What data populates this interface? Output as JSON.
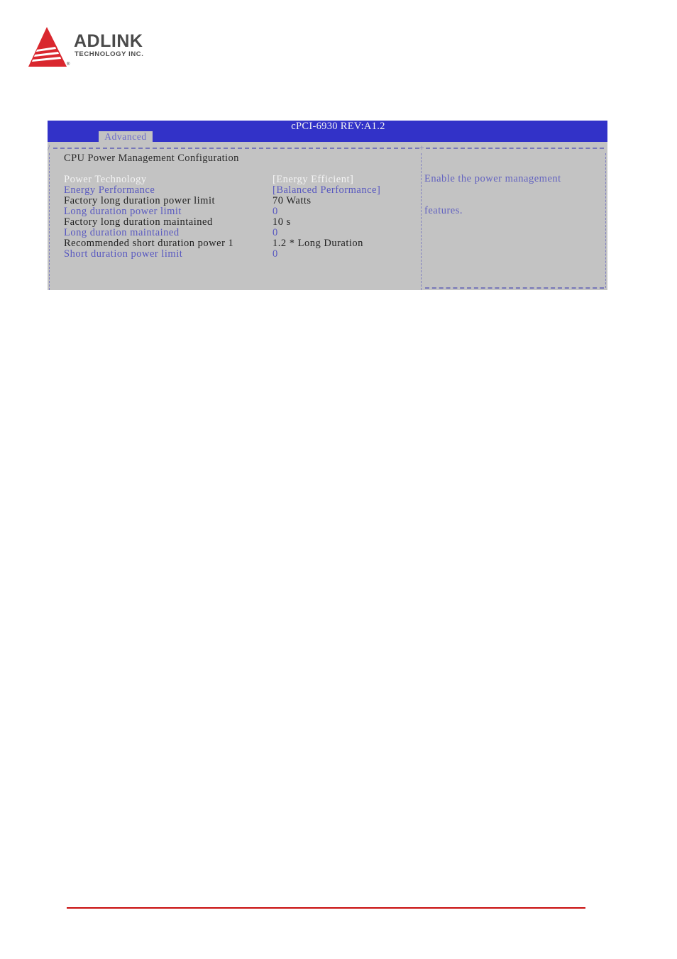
{
  "branding": {
    "company": "ADLINK",
    "subtitle": "TECHNOLOGY INC.",
    "registered_mark": "®",
    "brand_color": "#d9272e"
  },
  "bios": {
    "title": "cPCI-6930 REV:A1.2",
    "active_tab": "Advanced",
    "page_heading": "CPU Power Management Configuration",
    "items": [
      {
        "label": "Power Technology",
        "value": "[Energy Efficient]",
        "state": "selected"
      },
      {
        "label": "Energy Performance",
        "value": "[Balanced Performance]",
        "state": "config"
      },
      {
        "label": "Factory long duration power limit",
        "value": "70 Watts",
        "state": "info"
      },
      {
        "label": "Long duration power limit",
        "value": "0",
        "state": "config"
      },
      {
        "label": "Factory long duration maintained",
        "value": "10 s",
        "state": "info"
      },
      {
        "label": "Long duration maintained",
        "value": "0",
        "state": "config"
      },
      {
        "label": "Recommended short duration power 1",
        "value": "1.2 * Long Duration",
        "state": "info"
      },
      {
        "label": "Short duration power limit",
        "value": "0",
        "state": "config"
      }
    ],
    "help_text": [
      "Enable the power management",
      "features."
    ],
    "colors": {
      "titlebar": "#3232c8",
      "background": "#c3c3c3",
      "selected_text": "#f4f4f4",
      "config_text": "#5858c0",
      "info_text": "#222222"
    }
  },
  "footer": {
    "rule_color": "#c80d0d"
  }
}
